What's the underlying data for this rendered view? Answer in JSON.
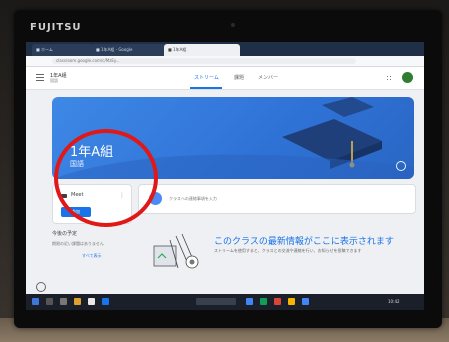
{
  "device": {
    "brand": "FUJITSU"
  },
  "browser": {
    "tabs": [
      {
        "label": "■ ホーム"
      },
      {
        "label": "■ 1年A組 - Google"
      },
      {
        "label": "■ 1年A組"
      }
    ],
    "url": "classroom.google.com/c/MzEy..."
  },
  "classroom": {
    "header": {
      "class_name": "1年A組",
      "section": "国語"
    },
    "nav_tabs": [
      {
        "label": "ストリーム",
        "active": true
      },
      {
        "label": "課題",
        "active": false
      },
      {
        "label": "メンバー",
        "active": false
      }
    ],
    "banner": {
      "title": "1年A組",
      "subject": "国語",
      "color": "#2f72d6"
    },
    "meet": {
      "label": "Meet",
      "join_button": "参加"
    },
    "post_prompt": "クラスへの連絡事項を入力",
    "upcoming": {
      "title": "今後の予定",
      "body": "期限の近い課題はありません",
      "link": "すべて表示"
    },
    "empty_state": {
      "headline": "このクラスの最新情報がここに表示されます",
      "description": "ストリームを使用すると、クラスとの交流や連絡を行い、お知らせを投稿できます"
    }
  },
  "taskbar": {
    "clock": "10:42"
  },
  "annotation": {
    "type": "red-circle",
    "color": "#e01818"
  }
}
